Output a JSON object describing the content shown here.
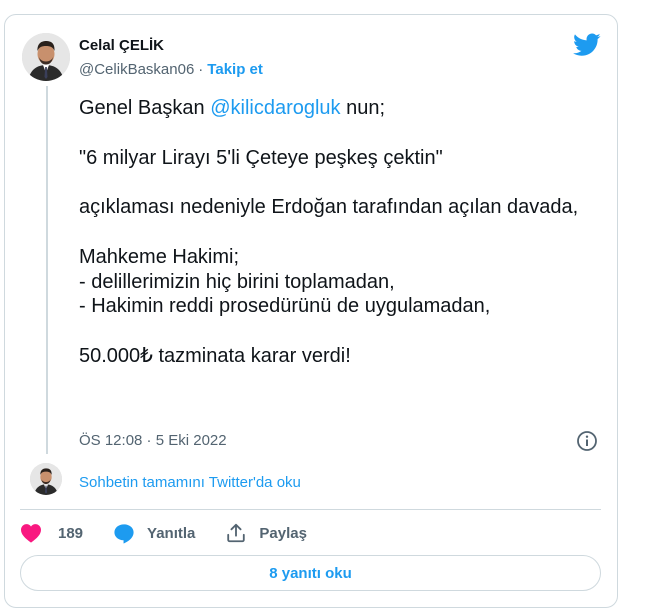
{
  "author": {
    "name": "Celal ÇELİK",
    "handle": "@CelikBaskan06",
    "separator": "·",
    "follow_label": "Takip et"
  },
  "tweet": {
    "line1_prefix": "Genel Başkan ",
    "mention": "@kilicdarogluk",
    "line1_suffix": " nun;",
    "rest": "\"6 milyar Lirayı 5'li Çeteye peşkeş çektin\"\n\naçıklaması nedeniyle Erdoğan tarafından açılan davada,\n\nMahkeme Hakimi;\n- delillerimizin hiç birini toplamadan,\n- Hakimin reddi prosedürünü de uygulamadan,\n\n50.000₺ tazminata karar verdi!",
    "timestamp": "ÖS 12:08 · 5 Eki 2022"
  },
  "thread": {
    "read_more": "Sohbetin tamamını Twitter'da oku"
  },
  "actions": {
    "like_count": "189",
    "reply_label": "Yanıtla",
    "share_label": "Paylaş",
    "read_replies": "8 yanıtı oku"
  },
  "colors": {
    "accent": "#1d9bf0",
    "like": "#f91880",
    "muted": "#536471"
  },
  "icons": [
    "twitter-bird-icon",
    "info-icon",
    "heart-icon",
    "reply-bubble-icon",
    "share-icon"
  ]
}
